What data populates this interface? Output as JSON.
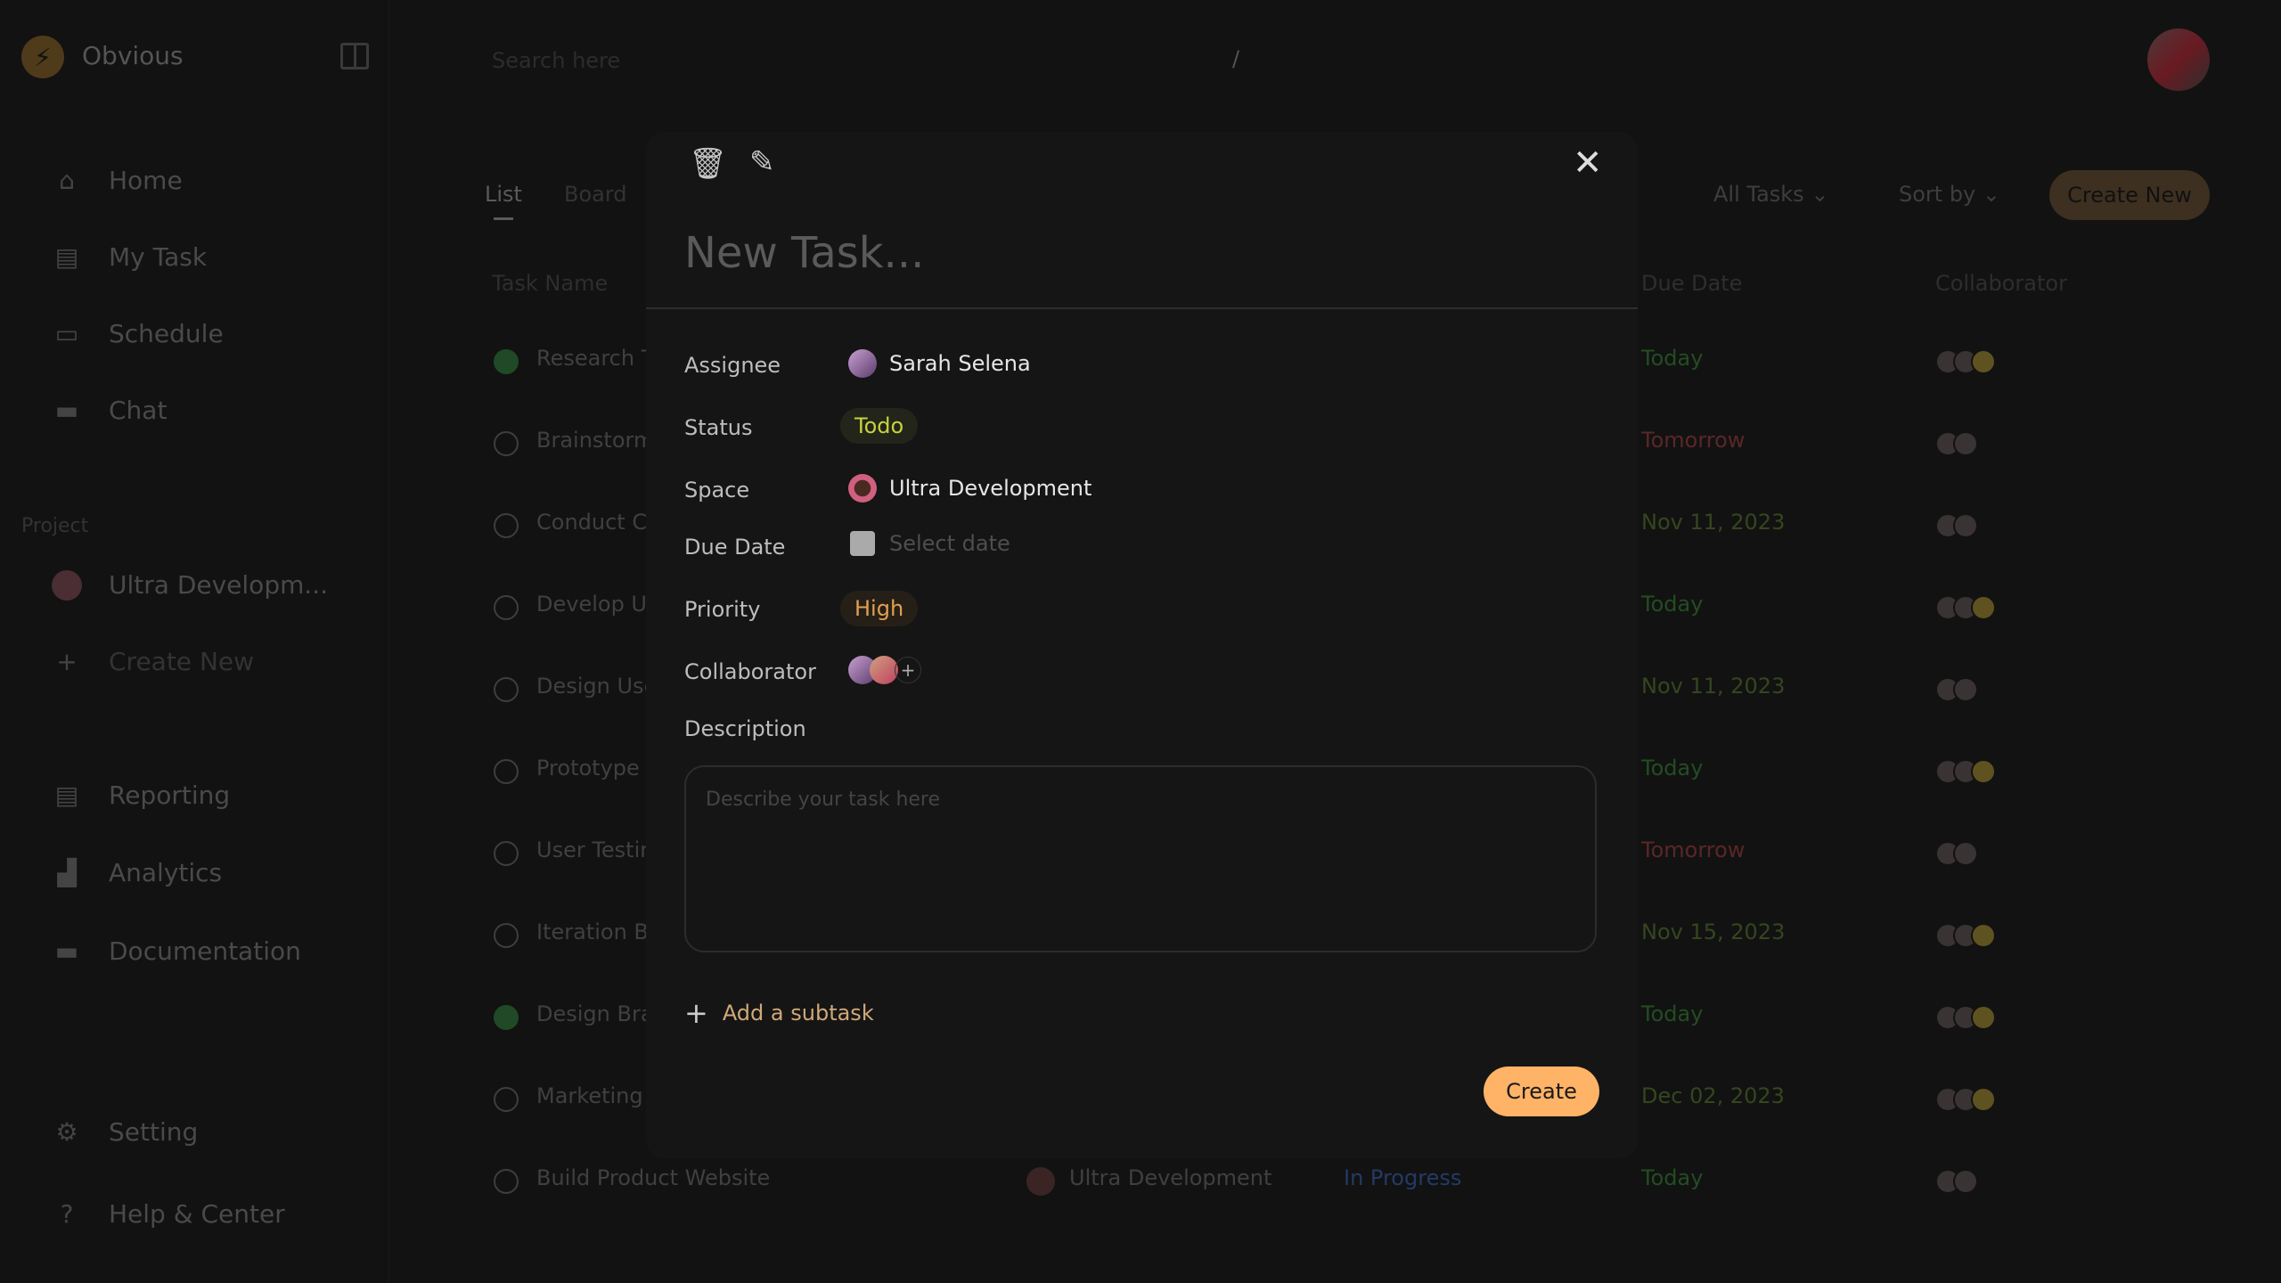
{
  "app": {
    "name": "Obvious"
  },
  "sidebar": {
    "nav": [
      {
        "label": "Home",
        "icon": "home-icon"
      },
      {
        "label": "My Task",
        "icon": "clipboard-icon"
      },
      {
        "label": "Schedule",
        "icon": "calendar-icon"
      },
      {
        "label": "Chat",
        "icon": "chat-icon"
      }
    ],
    "project_heading": "Project",
    "projects": [
      {
        "label": "Ultra Developm..."
      }
    ],
    "create_new": "Create New",
    "secondary": [
      {
        "label": "Reporting",
        "icon": "report-icon"
      },
      {
        "label": "Analytics",
        "icon": "bar-chart-icon"
      },
      {
        "label": "Documentation",
        "icon": "folder-icon"
      }
    ],
    "footer": [
      {
        "label": "Setting",
        "icon": "gear-icon"
      },
      {
        "label": "Help & Center",
        "icon": "help-icon"
      }
    ]
  },
  "header": {
    "search_placeholder": "Search here",
    "separator": "/"
  },
  "toolbar": {
    "tabs": [
      "List",
      "Board"
    ],
    "filter": "All Tasks",
    "sort": "Sort by",
    "create": "Create New"
  },
  "table": {
    "columns": {
      "name": "Task Name",
      "due": "Due Date",
      "collab": "Collaborator"
    },
    "rows": [
      {
        "name": "Research T",
        "due": "Today",
        "done": true,
        "collabs": 3
      },
      {
        "name": "Brainstorm",
        "due": "Tomorrow",
        "done": false,
        "collabs": 2
      },
      {
        "name": "Conduct C",
        "due": "Nov 11, 2023",
        "done": false,
        "collabs": 2
      },
      {
        "name": "Develop Us",
        "due": "Today",
        "done": false,
        "collabs": 3
      },
      {
        "name": "Design Use",
        "due": "Nov 11, 2023",
        "done": false,
        "collabs": 2
      },
      {
        "name": "Prototype",
        "due": "Today",
        "done": false,
        "collabs": 3
      },
      {
        "name": "User Testir",
        "due": "Tomorrow",
        "done": false,
        "collabs": 2
      },
      {
        "name": "Iteration Ba",
        "due": "Nov 15, 2023",
        "done": false,
        "collabs": 3
      },
      {
        "name": "Design Bra",
        "due": "Today",
        "done": true,
        "collabs": 3
      },
      {
        "name": "Marketing",
        "due": "Dec 02, 2023",
        "done": false,
        "collabs": 3
      },
      {
        "name": "Build Product Website",
        "space": "Ultra Development",
        "status": "In Progress",
        "due": "Today",
        "done": false,
        "collabs": 2
      }
    ]
  },
  "modal": {
    "title_placeholder": "New Task...",
    "fields": {
      "assignee_label": "Assignee",
      "assignee": "Sarah Selena",
      "status_label": "Status",
      "status": "Todo",
      "space_label": "Space",
      "space": "Ultra Development",
      "due_label": "Due Date",
      "due_placeholder": "Select date",
      "priority_label": "Priority",
      "priority": "High",
      "collab_label": "Collaborator",
      "collab_add": "+",
      "desc_label": "Description",
      "desc_placeholder": "Describe your task here"
    },
    "add_subtask": "Add a subtask",
    "create": "Create",
    "colors": {
      "accent": "#ffb366",
      "todo": "#c8d23c",
      "high": "#e0a050"
    }
  }
}
